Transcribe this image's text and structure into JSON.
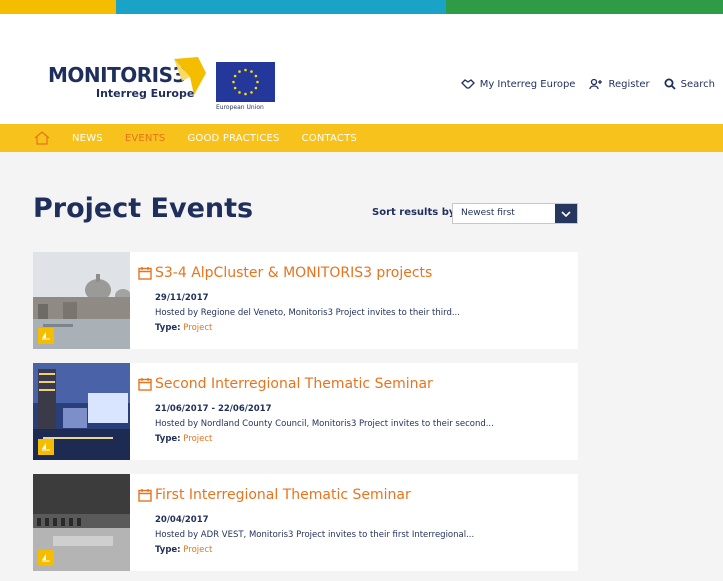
{
  "brand": {
    "name": "MONITORIS3",
    "sub_bold": "Interreg",
    "sub_rest": " Europe",
    "eu_label": "European Union"
  },
  "toplinks": [
    {
      "label": "My Interreg Europe",
      "icon": "handshake-icon"
    },
    {
      "label": "Register",
      "icon": "add-user-icon"
    },
    {
      "label": "Search",
      "icon": "search-icon"
    }
  ],
  "nav": {
    "home_icon": "home-icon",
    "items": [
      {
        "label": "NEWS",
        "active": false
      },
      {
        "label": "EVENTS",
        "active": true
      },
      {
        "label": "GOOD PRACTICES",
        "active": false
      },
      {
        "label": "CONTACTS",
        "active": false
      }
    ]
  },
  "page": {
    "title": "Project Events"
  },
  "sort": {
    "label": "Sort results by",
    "value": "Newest first"
  },
  "events": [
    {
      "title": "S3-4 AlpCluster & MONITORIS3 projects",
      "date": "29/11/2017",
      "description": "Hosted by Regione del Veneto, Monitoris3 Project invites to their third...",
      "type_label": "Type:",
      "type_value": "Project"
    },
    {
      "title": "Second Interregional Thematic Seminar",
      "date": "21/06/2017 - 22/06/2017",
      "description": "Hosted by Nordland County Council, Monitoris3 Project invites to their second...",
      "type_label": "Type:",
      "type_value": "Project"
    },
    {
      "title": "First Interregional Thematic Seminar",
      "date": "20/04/2017",
      "description": "Hosted by ADR VEST, Monitoris3 Project invites to their first Interregional...",
      "type_label": "Type:",
      "type_value": "Project"
    }
  ],
  "colors": {
    "navy": "#1f2f5c",
    "yellow": "#f6c21b",
    "orange": "#e8731e"
  }
}
